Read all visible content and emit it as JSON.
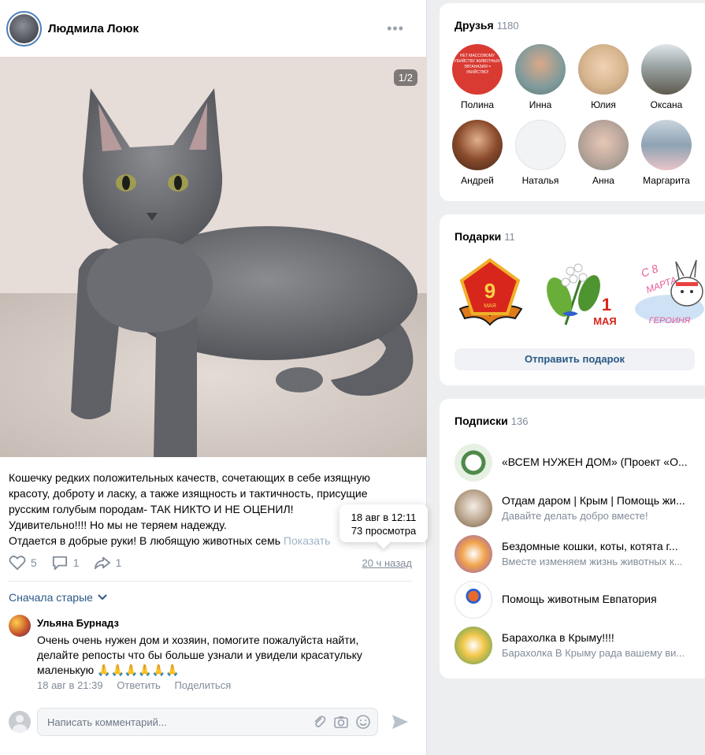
{
  "post": {
    "author": "Людмила Лоюк",
    "more_icon": "•••",
    "photo_counter": "1/2",
    "text": [
      "Кошечку редких положительных качеств, сочетающих в себе изящную",
      "красоту, доброту и ласку, а также изящность и тактичность, присущие",
      "русским голубым породам- ТАК НИКТО И НЕ ОЦЕНИЛ!",
      "Удивительно!!!! Но мы не теряем надежду.",
      "Отдается в добрые руки! В любящую животных семь"
    ],
    "show_more": "Показать",
    "tooltip": {
      "date": "18 авг в 12:11",
      "views": "73 просмотра"
    },
    "likes": "5",
    "comments": "1",
    "shares": "1",
    "time_ago": "20 ч назад"
  },
  "comments_section": {
    "sort_label": "Сначала старые",
    "comment": {
      "name": "Ульяна Бурнадз",
      "text": [
        "Очень очень нужен дом и хозяин, помогите пожалуйста найти,",
        "делайте репосты что бы больше узнали и увидели красатульку",
        "маленькую 🙏🙏🙏🙏🙏🙏"
      ],
      "date": "18 авг в 21:39",
      "reply": "Ответить",
      "share": "Поделиться"
    },
    "input_placeholder": "Написать комментарий..."
  },
  "friends": {
    "title": "Друзья",
    "count": "1180",
    "items": [
      {
        "name": "Полина",
        "color": "#d93a32"
      },
      {
        "name": "Инна",
        "color": "#7f9a9c"
      },
      {
        "name": "Юлия",
        "color": "#d6b58e"
      },
      {
        "name": "Оксана",
        "color": "#8a8f8a"
      },
      {
        "name": "Андрей",
        "color": "#8a4b2c"
      },
      {
        "name": "Наталья",
        "color": "#f2f3f5"
      },
      {
        "name": "Анна",
        "color": "#b8a49a"
      },
      {
        "name": "Маргарита",
        "color": "#8ea3b4"
      }
    ],
    "avatar_text": "НЕТ МАССОВОМУ УБИЙСТВУ ЖИВОТНЫХ! ЭВТАНАЗИЯ = УБИЙСТВО!"
  },
  "gifts": {
    "title": "Подарки",
    "count": "11",
    "items": [
      {
        "icon": "victory-day-star-icon",
        "text": "9 МАЯ"
      },
      {
        "icon": "lily-of-the-valley-icon",
        "text": "1 МАЯ"
      },
      {
        "icon": "march-8-bunny-icon",
        "text": "С 8 МАРТА ГЕРОИНЯ"
      }
    ],
    "send_label": "Отправить подарок"
  },
  "subscriptions": {
    "title": "Подписки",
    "count": "136",
    "items": [
      {
        "name": "«ВСЕМ НУЖЕН ДОМ» (Проект «О...",
        "desc": "",
        "color": "#4f8a4b"
      },
      {
        "name": "Отдам даром | Крым | Помощь жи...",
        "desc": "Давайте делать добро вместе!",
        "color": "#b9a28a"
      },
      {
        "name": "Бездомные кошки, коты, котята г...",
        "desc": "Вместе изменяем жизнь животных к...",
        "color": "#f0a24a"
      },
      {
        "name": "Помощь животным Евпатория",
        "desc": "",
        "color": "#ffffff"
      },
      {
        "name": "Барахолка в Крыму!!!!",
        "desc": "Барахолка В Крыму рада вашему ви...",
        "color": "#f2c74a"
      }
    ]
  }
}
